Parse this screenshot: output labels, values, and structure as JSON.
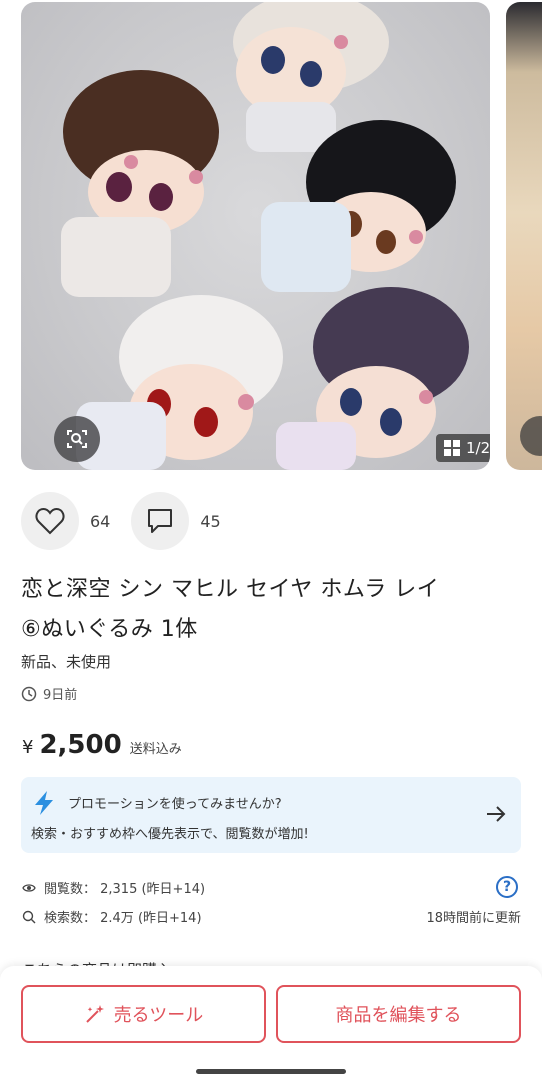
{
  "gallery": {
    "page_indicator": "1/2",
    "photo": "Product photo: five plush dolls with pink flower hair accessories on a grey background"
  },
  "engagement": {
    "likes": "64",
    "comments": "45"
  },
  "product": {
    "title_line1": "恋と深空 シン マヒル セイヤ ホムラ レイ",
    "title_line2": "⑥ぬいぐるみ 1体",
    "condition": "新品、未使用",
    "posted": "9日前",
    "price_symbol": "¥",
    "price": "2,500",
    "shipping": "送料込み"
  },
  "promo": {
    "title": "プロモーションを使ってみませんか?",
    "description": "検索・おすすめ枠へ優先表示で、閲覧数が増加!"
  },
  "stats": {
    "views": "閲覧数： 2,315 (昨日+14)",
    "searches": "検索数： 2.4万 (昨日+14)",
    "updated": "18時間前に更新"
  },
  "note": "こちらの商品は即購入",
  "buttons": {
    "sell_tool": "売るツール",
    "edit": "商品を編集する"
  },
  "colors": {
    "accent": "#e0535b",
    "promo_bg": "#eaf4fc",
    "bolt": "#2b8fe0",
    "help": "#2b6fc6"
  }
}
